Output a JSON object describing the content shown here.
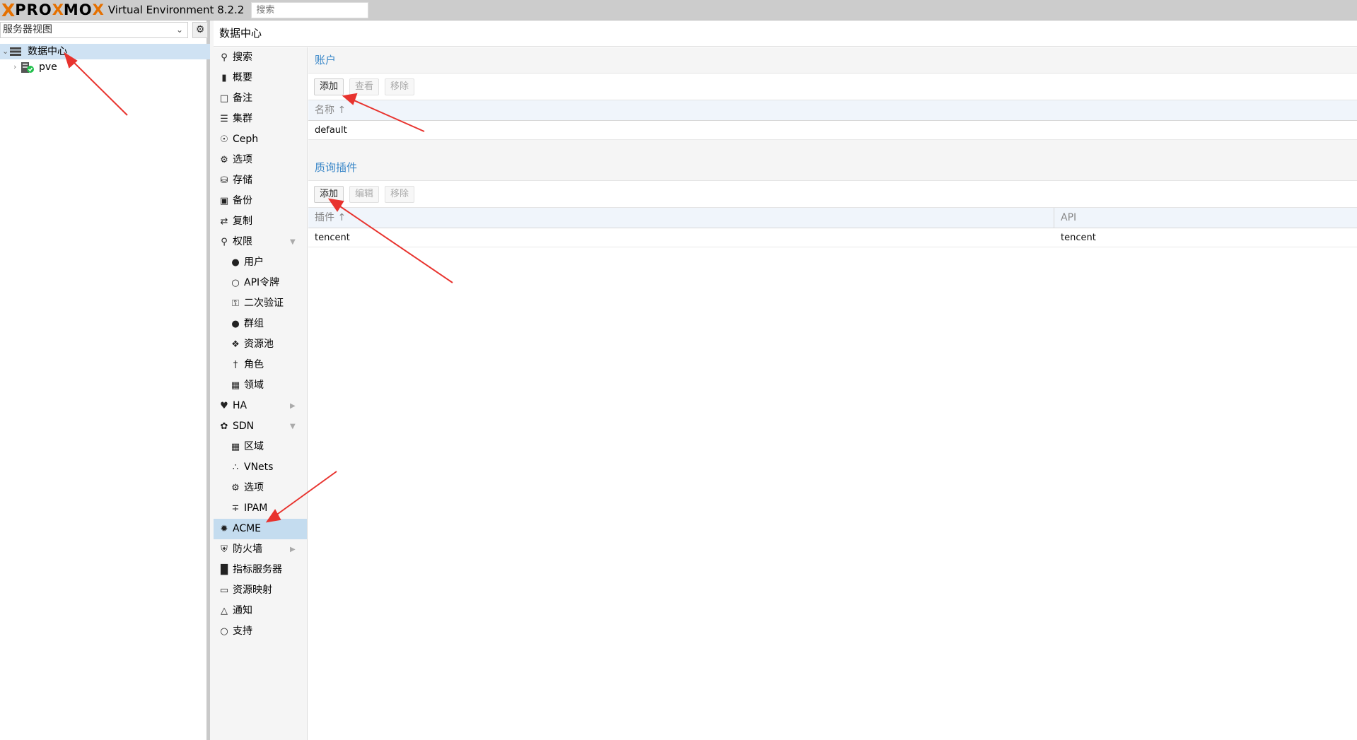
{
  "header": {
    "logo_x": "X",
    "logo_text_1": "PRO",
    "logo_text_2": "MO",
    "version": "Virtual Environment 8.2.2",
    "search_placeholder": "搜索"
  },
  "left_panel": {
    "view_select": "服务器视图",
    "tree": {
      "datacenter_label": "数据中心",
      "node_label": "pve"
    }
  },
  "breadcrumb": "数据中心",
  "nav": {
    "items": [
      {
        "label": "搜索",
        "icon": "search-icon"
      },
      {
        "label": "概要",
        "icon": "book-icon"
      },
      {
        "label": "备注",
        "icon": "note-icon"
      },
      {
        "label": "集群",
        "icon": "server-icon"
      },
      {
        "label": "Ceph",
        "icon": "ceph-icon"
      },
      {
        "label": "选项",
        "icon": "gear-icon"
      },
      {
        "label": "存储",
        "icon": "database-icon"
      },
      {
        "label": "备份",
        "icon": "floppy-icon"
      },
      {
        "label": "复制",
        "icon": "retweet-icon"
      },
      {
        "label": "权限",
        "icon": "unlock-icon"
      },
      {
        "label": "用户",
        "icon": "user-icon"
      },
      {
        "label": "API令牌",
        "icon": "user-outline-icon"
      },
      {
        "label": "二次验证",
        "icon": "key-icon"
      },
      {
        "label": "群组",
        "icon": "users-icon"
      },
      {
        "label": "资源池",
        "icon": "tags-icon"
      },
      {
        "label": "角色",
        "icon": "male-icon"
      },
      {
        "label": "领域",
        "icon": "address-book-icon"
      },
      {
        "label": "HA",
        "icon": "heartbeat-icon"
      },
      {
        "label": "SDN",
        "icon": "sdn-icon"
      },
      {
        "label": "区域",
        "icon": "th-icon"
      },
      {
        "label": "VNets",
        "icon": "sitemap-icon"
      },
      {
        "label": "选项",
        "icon": "gear-icon"
      },
      {
        "label": "IPAM",
        "icon": "signs-icon"
      },
      {
        "label": "ACME",
        "icon": "certificate-icon"
      },
      {
        "label": "防火墙",
        "icon": "shield-icon"
      },
      {
        "label": "指标服务器",
        "icon": "bar-chart-icon"
      },
      {
        "label": "资源映射",
        "icon": "folder-icon"
      },
      {
        "label": "通知",
        "icon": "bell-icon"
      },
      {
        "label": "支持",
        "icon": "comments-icon"
      }
    ],
    "selected": "ACME"
  },
  "accounts": {
    "title": "账户",
    "buttons": {
      "add": "添加",
      "view": "查看",
      "remove": "移除"
    },
    "columns": [
      "名称 ↑"
    ],
    "rows": [
      [
        "default"
      ]
    ]
  },
  "plugins": {
    "title": "质询插件",
    "buttons": {
      "add": "添加",
      "edit": "编辑",
      "remove": "移除"
    },
    "columns": [
      "插件 ↑",
      "API"
    ],
    "rows": [
      [
        "tencent",
        "tencent"
      ]
    ]
  },
  "colors": {
    "accent": "#3a87c8",
    "logo_orange": "#e57000",
    "selection": "#c4dcef",
    "annotation_arrow": "#e8332e"
  }
}
